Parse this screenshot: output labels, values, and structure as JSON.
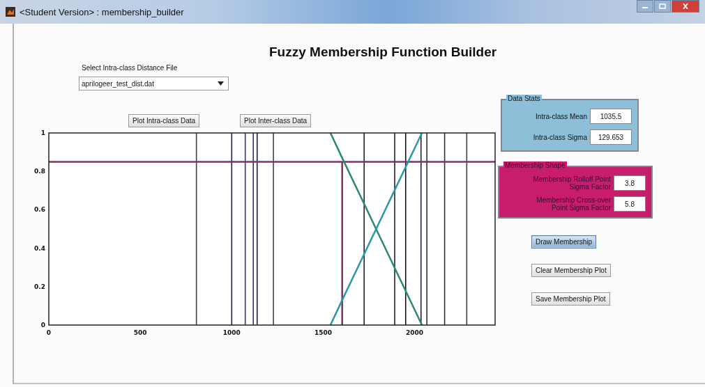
{
  "window": {
    "title": "<Student Version> : membership_builder"
  },
  "heading": "Fuzzy Membership Function Builder",
  "file_select": {
    "label": "Select Intra-class Distance File",
    "value": "aprilogeer_test_dist.dat"
  },
  "plot_buttons": [
    "Plot Intra-class Data",
    "Plot Inter-class Data"
  ],
  "chart": {
    "chart_data": {
      "type": "line",
      "x": [
        0,
        1540,
        1604,
        1604,
        2040,
        2440
      ],
      "xlim": [
        0,
        2440
      ],
      "ylim": [
        0,
        1
      ],
      "xticks": [
        0,
        500,
        1000,
        1500,
        2000
      ],
      "yticks": [
        0,
        0.2,
        0.4,
        0.6,
        0.8,
        1
      ],
      "series": [
        {
          "color": "#8a2a6a",
          "values": [
            0.85,
            0.85,
            0.85,
            0.85,
            0.85,
            0.85
          ]
        },
        {
          "color": "#8a2a6a",
          "values": [
            null,
            null,
            0,
            0.85,
            null,
            null
          ]
        },
        {
          "color": "#2a8a70",
          "values": [
            null,
            1,
            0.87,
            0.87,
            0,
            null
          ]
        },
        {
          "color": "#2a98a8",
          "values": [
            null,
            0,
            0.13,
            0.13,
            1,
            null
          ]
        }
      ],
      "ref_lines": [
        {
          "axis": "x",
          "value": 807,
          "color": "#404050"
        },
        {
          "axis": "x",
          "value": 1000,
          "color": "#202040"
        },
        {
          "axis": "x",
          "value": 1074,
          "color": "#2a3a8a"
        },
        {
          "axis": "x",
          "value": 1118,
          "color": "#303050"
        },
        {
          "axis": "x",
          "value": 1139,
          "color": "#202040"
        },
        {
          "axis": "x",
          "value": 1228,
          "color": "#404050"
        },
        {
          "axis": "x",
          "value": 1724,
          "color": "#202030"
        },
        {
          "axis": "x",
          "value": 1891,
          "color": "#202030"
        },
        {
          "axis": "x",
          "value": 1951,
          "color": "#101010"
        },
        {
          "axis": "x",
          "value": 2035,
          "color": "#202040"
        },
        {
          "axis": "x",
          "value": 2067,
          "color": "#303040"
        },
        {
          "axis": "x",
          "value": 2164,
          "color": "#303040"
        },
        {
          "axis": "x",
          "value": 2285,
          "color": "#404050"
        }
      ]
    }
  },
  "data_stats": {
    "title": "Data Stats",
    "fields": [
      {
        "label": "Intra-class Mean",
        "value": "1035.5"
      },
      {
        "label": "Intra-class Sigma",
        "value": "129.653"
      }
    ]
  },
  "membership_shape": {
    "title": "Membership Shape",
    "fields": [
      {
        "label": "Membership Rolloff Point Sigma Factor",
        "value": "3.8"
      },
      {
        "label": "Membership Cross-over Point Sigma Factor",
        "value": "5.8"
      }
    ]
  },
  "actions": [
    {
      "label": "Draw Membership",
      "selected": true
    },
    {
      "label": "Clear Membership Plot",
      "selected": false
    },
    {
      "label": "Save Membership Plot",
      "selected": false
    }
  ]
}
